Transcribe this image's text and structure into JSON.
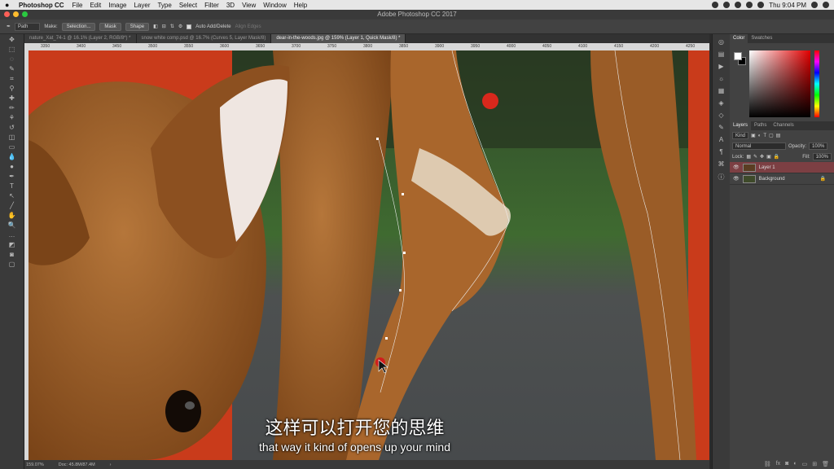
{
  "menubar": {
    "app": "Photoshop CC",
    "items": [
      "File",
      "Edit",
      "Image",
      "Layer",
      "Type",
      "Select",
      "Filter",
      "3D",
      "View",
      "Window",
      "Help"
    ],
    "clock": "Thu 9:04 PM"
  },
  "window": {
    "title": "Adobe Photoshop CC 2017"
  },
  "options": {
    "mode": "Path",
    "make_label": "Make:",
    "selection": "Selection...",
    "mask": "Mask",
    "shape": "Shape",
    "auto_add": "Auto Add/Delete",
    "align_edges": "Align Edges"
  },
  "tabs": [
    {
      "label": "nature_Xat_74-1 @ 16.1% (Layer 2, RGB/8*) *"
    },
    {
      "label": "snow white comp.psd @ 16.7% (Curves 5, Layer Mask/8)"
    },
    {
      "label": "dear-in-the-woods.jpg @ 159% (Layer 1, Quick Mask/8) *"
    }
  ],
  "ruler": {
    "ticks": [
      "3350",
      "3400",
      "3450",
      "3500",
      "3550",
      "3600",
      "3650",
      "3700",
      "3750",
      "3800",
      "3850",
      "3900",
      "3950",
      "4000",
      "4050",
      "4100",
      "4150",
      "4200",
      "4250"
    ]
  },
  "status": {
    "zoom": "159.07%",
    "doc": "Doc: 45.8M/87.4M"
  },
  "panels": {
    "color_tabs": [
      "Color",
      "Swatches"
    ],
    "layer_tabs": [
      "Layers",
      "Paths",
      "Channels"
    ],
    "kind": "Kind",
    "blend": "Normal",
    "opacity_label": "Opacity:",
    "opacity": "100%",
    "lock_label": "Lock:",
    "fill_label": "Fill:",
    "fill": "100%",
    "layers": [
      {
        "name": "Layer 1",
        "selected": true
      },
      {
        "name": "Background",
        "selected": false
      }
    ]
  },
  "subtitles": {
    "cn": "这样可以打开您的思维",
    "en": "that way it kind of opens up your mind"
  }
}
